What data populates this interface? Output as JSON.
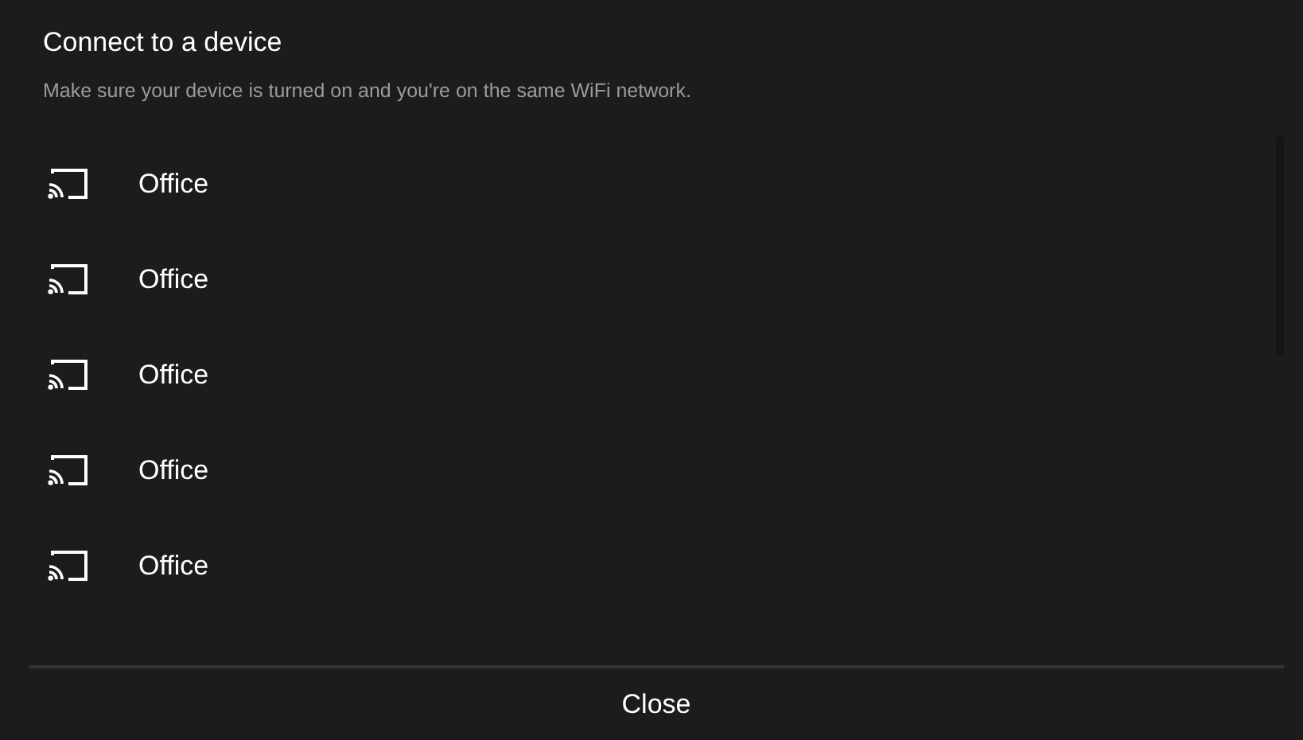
{
  "dialog": {
    "title": "Connect to a device",
    "subtitle": "Make sure your device is turned on and you're on the same WiFi network."
  },
  "devices": [
    {
      "name": "Office"
    },
    {
      "name": "Office"
    },
    {
      "name": "Office"
    },
    {
      "name": "Office"
    },
    {
      "name": "Office"
    }
  ],
  "buttons": [
    {
      "label": "Close"
    }
  ]
}
